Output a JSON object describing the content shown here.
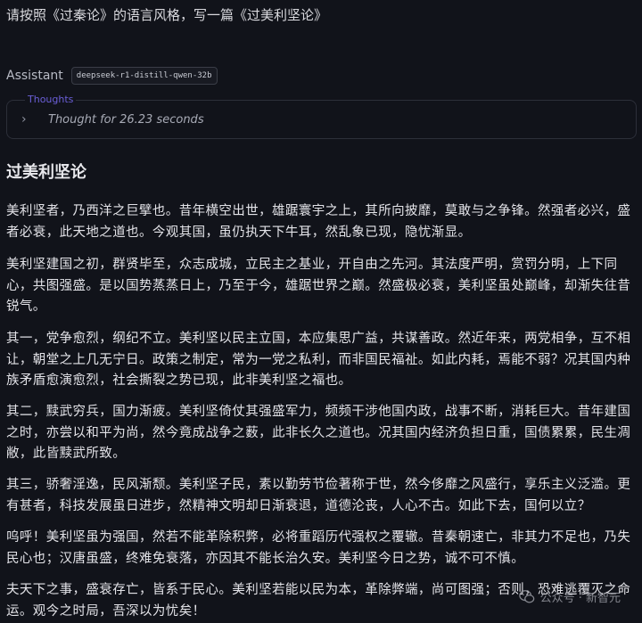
{
  "prompt": "请按照《过秦论》的语言风格，写一篇《过美利坚论》",
  "assistant": {
    "label": "Assistant",
    "model": "deepseek-r1-distill-qwen-32b"
  },
  "thoughts": {
    "title": "Thoughts",
    "summary": "Thought for 26.23 seconds"
  },
  "essay": {
    "title": "过美利坚论",
    "paragraphs": [
      "美利坚者，乃西洋之巨擘也。昔年横空出世，雄踞寰宇之上，其所向披靡，莫敢与之争锋。然强者必兴，盛者必衰，此天地之道也。今观其国，虽仍执天下牛耳，然乱象已现，隐忧渐显。",
      "美利坚建国之初，群贤毕至，众志成城，立民主之基业，开自由之先河。其法度严明，赏罚分明，上下同心，共图强盛。是以国势蒸蒸日上，乃至于今，雄踞世界之巅。然盛极必衰，美利坚虽处巅峰，却渐失往昔锐气。",
      "其一，党争愈烈，纲纪不立。美利坚以民主立国，本应集思广益，共谋善政。然近年来，两党相争，互不相让，朝堂之上几无宁日。政策之制定，常为一党之私利，而非国民福祉。如此内耗，焉能不弱？况其国内种族矛盾愈演愈烈，社会撕裂之势已现，此非美利坚之福也。",
      "其二，黩武穷兵，国力渐疲。美利坚倚仗其强盛军力，频频干涉他国内政，战事不断，消耗巨大。昔年建国之时，亦尝以和平为尚，然今竟成战争之薮，此非长久之道也。况其国内经济负担日重，国债累累，民生凋敝，此皆黩武所致。",
      "其三，骄奢淫逸，民风渐颓。美利坚子民，素以勤劳节俭著称于世，然今侈靡之风盛行，享乐主义泛滥。更有甚者，科技发展虽日进步，然精神文明却日渐衰退，道德沦丧，人心不古。如此下去，国何以立？",
      "呜呼！美利坚虽为强国，然若不能革除积弊，必将重蹈历代强权之覆辙。昔秦朝速亡，非其力不足也，乃失民心也；汉唐虽盛，终难免衰落，亦因其不能长治久安。美利坚今日之势，诚不可不慎。",
      "夫天下之事，盛衰存亡，皆系于民心。美利坚若能以民为本，革除弊端，尚可图强；否则，恐难逃覆灭之命运。观今之时局，吾深以为忧矣！"
    ]
  },
  "watermark": {
    "text": "公众号 · 新智元",
    "icon": "wechat-icon"
  }
}
